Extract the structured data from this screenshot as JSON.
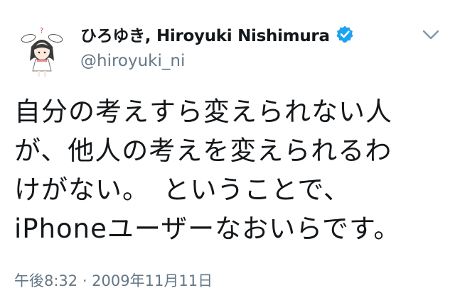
{
  "tweet": {
    "display_name": "ひろゆき, Hiroyuki Nishimura",
    "handle": "@hiroyuki_ni",
    "verified_icon": "verified-badge-icon",
    "menu_icon": "chevron-down-icon",
    "avatar_icon": "anime-girl-avatar",
    "text_lines": [
      "自分の考えすら変えられない人",
      "が、他人の考えを変えられるわ",
      "けがない。　ということで、",
      "iPhoneユーザーなおいらです。"
    ],
    "timestamp": "午後8:32 · 2009年11月11日"
  },
  "colors": {
    "text": "#14171a",
    "secondary": "#657786",
    "verified_blue": "#1da1f2"
  }
}
